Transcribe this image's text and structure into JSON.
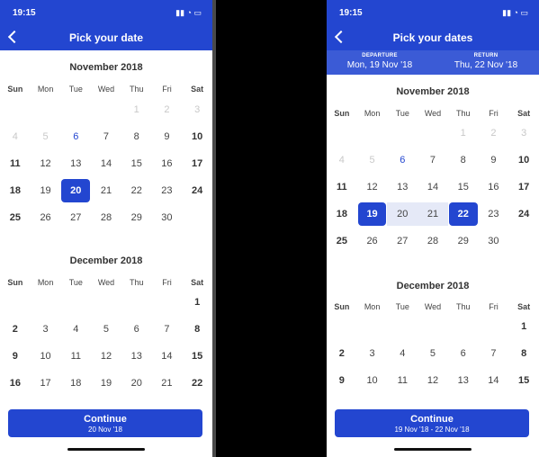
{
  "left": {
    "time": "19:15",
    "title": "Pick your date",
    "weekdays": [
      "Sun",
      "Mon",
      "Tue",
      "Wed",
      "Thu",
      "Fri",
      "Sat"
    ],
    "months": [
      {
        "title": "November 2018",
        "days": [
          "",
          "",
          "",
          "",
          "1",
          "2",
          "3",
          "4",
          "5",
          "6",
          "7",
          "8",
          "9",
          "10",
          "11",
          "12",
          "13",
          "14",
          "15",
          "16",
          "17",
          "18",
          "19",
          "20",
          "21",
          "22",
          "23",
          "24",
          "25",
          "26",
          "27",
          "28",
          "29",
          "30",
          ""
        ],
        "disabled": [
          "1",
          "2",
          "3",
          "4",
          "5"
        ],
        "today": "6",
        "selected": [
          "20"
        ]
      },
      {
        "title": "December 2018",
        "days": [
          "",
          "",
          "",
          "",
          "",
          "",
          "1",
          "2",
          "3",
          "4",
          "5",
          "6",
          "7",
          "8",
          "9",
          "10",
          "11",
          "12",
          "13",
          "14",
          "15",
          "16",
          "17",
          "18",
          "19",
          "20",
          "21",
          "22"
        ],
        "disabled": [],
        "today": "",
        "selected": []
      }
    ],
    "cta": {
      "label": "Continue",
      "sub": "20 Nov '18"
    }
  },
  "right": {
    "time": "19:15",
    "title": "Pick your dates",
    "departure_label": "DEPARTURE",
    "departure_value": "Mon, 19 Nov '18",
    "return_label": "RETURN",
    "return_value": "Thu, 22 Nov '18",
    "weekdays": [
      "Sun",
      "Mon",
      "Tue",
      "Wed",
      "Thu",
      "Fri",
      "Sat"
    ],
    "months": [
      {
        "title": "November 2018",
        "days": [
          "",
          "",
          "",
          "",
          "1",
          "2",
          "3",
          "4",
          "5",
          "6",
          "7",
          "8",
          "9",
          "10",
          "11",
          "12",
          "13",
          "14",
          "15",
          "16",
          "17",
          "18",
          "19",
          "20",
          "21",
          "22",
          "23",
          "24",
          "25",
          "26",
          "27",
          "28",
          "29",
          "30",
          ""
        ],
        "disabled": [
          "1",
          "2",
          "3",
          "4",
          "5"
        ],
        "today": "6",
        "selected": [
          "19",
          "22"
        ],
        "inrange": [
          "20",
          "21"
        ]
      },
      {
        "title": "December 2018",
        "days": [
          "",
          "",
          "",
          "",
          "",
          "",
          "1",
          "2",
          "3",
          "4",
          "5",
          "6",
          "7",
          "8",
          "9",
          "10",
          "11",
          "12",
          "13",
          "14",
          "15"
        ],
        "disabled": [],
        "today": "",
        "selected": [],
        "inrange": []
      }
    ],
    "cta": {
      "label": "Continue",
      "sub": "19 Nov '18 - 22 Nov '18"
    }
  },
  "colors": {
    "brand": "#2346d0",
    "range_bg": "#e5e9f7"
  }
}
